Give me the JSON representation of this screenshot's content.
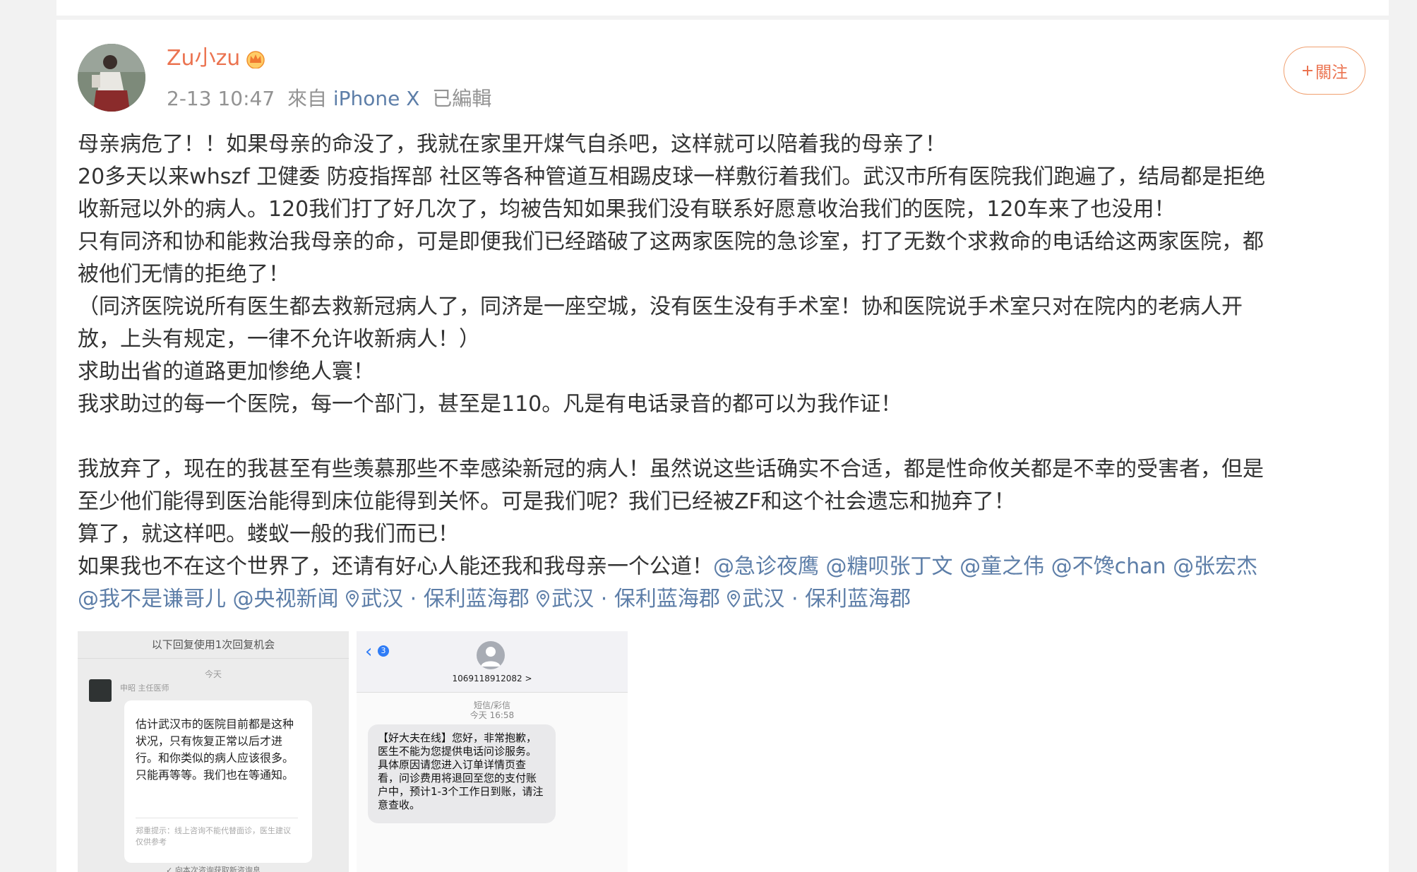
{
  "post": {
    "username": "Zu小zu",
    "timestamp": "2-13 10:47",
    "source_prefix": "來自",
    "source": "iPhone X",
    "edited": "已編輯",
    "follow_label": "關注",
    "lines": [
      "母亲病危了！！如果母亲的命没了，我就在家里开煤气自杀吧，这样就可以陪着我的母亲了！",
      "20多天以来whszf 卫健委 防疫指挥部 社区等各种管道互相踢皮球一样敷衍着我们。武汉市所有医院我们跑遍了，结局都是拒绝",
      "收新冠以外的病人。120我们打了好几次了，均被告知如果我们没有联系好愿意收治我们的医院，120车来了也没用！",
      "只有同济和协和能救治我母亲的命，可是即便我们已经踏破了这两家医院的急诊室，打了无数个求救命的电话给这两家医院，都",
      "被他们无情的拒绝了！",
      "（同济医院说所有医生都去救新冠病人了，同济是一座空城，没有医生没有手术室！协和医院说手术室只对在院内的老病人开",
      "放，上头有规定，一律不允许收新病人！）",
      "求助出省的道路更加惨绝人寰！",
      "我求助过的每一个医院，每一个部门，甚至是110。凡是有电话录音的都可以为我作证！",
      "我放弃了，现在的我甚至有些羡慕那些不幸感染新冠的病人！虽然说这些话确实不合适，都是性命攸关都是不幸的受害者，但是",
      "至少他们能得到医治能得到床位能得到关怀。可是我们呢？我们已经被ZF和这个社会遗忘和抛弃了！",
      "算了，就这样吧。蝼蚁一般的我们而已！",
      "如果我也不在这个世界了，还请有好心人能还我和我母亲一个公道！"
    ],
    "mentions": [
      "@急诊夜鹰",
      "@糖呗张丁文",
      "@童之伟",
      "@不馋chan",
      "@张宏杰",
      "@我不是谦哥儿",
      "@央视新闻"
    ],
    "locations": [
      "武汉 · 保利蓝海郡",
      "武汉 · 保利蓝海郡",
      "武汉 · 保利蓝海郡"
    ]
  },
  "image1": {
    "header": "以下回复使用1次回复机会",
    "date": "今天",
    "doctor": "申昭 主任医师",
    "message": "估计武汉市的医院目前都是这种状况，只有恢复正常以后才进行。和你类似的病人应该很多。只能再等等。我们也在等通知。",
    "note": "郑重提示：线上咨询不能代替面诊，医生建议仅供参考",
    "bottom": "✓ 向本次咨询获取新咨询息"
  },
  "image2": {
    "back_count": "3",
    "number": "1069118912082 >",
    "label_line1": "短信/彩信",
    "label_line2": "今天 16:58",
    "message": "【好大夫在线】您好，非常抱歉，医生不能为您提供电话问诊服务。具体原因请您进入订单详情页查看，问诊费用将退回至您的支付账户中，预计1-3个工作日到账，请注意查收。"
  },
  "colors": {
    "accent": "#eb7350",
    "link": "#5d7ea8",
    "meta": "#939393",
    "text": "#333333"
  },
  "icons": [
    "crown-icon",
    "plus-icon",
    "location-pin-icon",
    "back-chevron-icon",
    "contact-avatar-icon"
  ]
}
